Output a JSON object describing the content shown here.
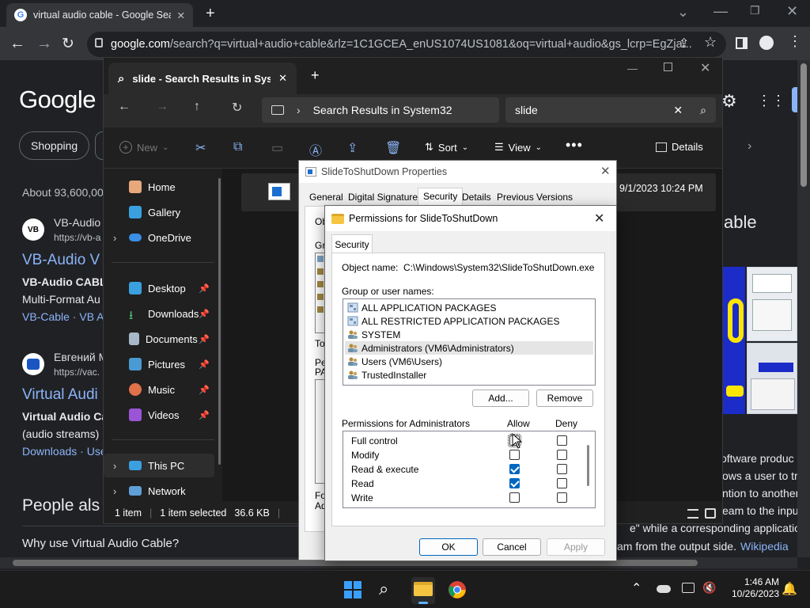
{
  "chrome": {
    "tab_title": "virtual audio cable - Google Sea",
    "url_host": "google.com",
    "url_rest": "/search?q=virtual+audio+cable&rlz=1C1GCEA_enUS1074US1081&oq=virtual+audio&gs_lcrp=EgZja..."
  },
  "google": {
    "logo": "Google",
    "chip_shopping": "Shopping",
    "about": "About 93,600,00",
    "result1": {
      "site": "VB-Audio",
      "url": "https://vb-a",
      "title": "VB-Audio V",
      "bold": "VB-Audio CABL",
      "desc": "Multi-Format Au",
      "links": "VB-Cable · VB Au"
    },
    "result2": {
      "site": "Евгений M",
      "url": "https://vac.",
      "title": "Virtual Audi",
      "bold": "Virtual Audio Ca",
      "desc": "(audio streams)",
      "links": "Downloads · Use"
    },
    "people": "People als",
    "why": "Why use Virtual Audio Cable?",
    "right_heading": "able",
    "right_text": [
      "oftware produc",
      "ows a user to tr",
      "ntion to another",
      "eam to the inpu",
      "e\" while a corresponding application",
      "am from the output side."
    ],
    "wikipedia": "Wikipedia"
  },
  "explorer": {
    "tab_title": "slide - Search Results in Syster",
    "address": "Search Results in System32",
    "search": "slide",
    "cmd": {
      "new": "New",
      "sort": "Sort",
      "view": "View",
      "details": "Details"
    },
    "nav": {
      "home": "Home",
      "gallery": "Gallery",
      "onedrive": "OneDrive",
      "desktop": "Desktop",
      "downloads": "Downloads",
      "documents": "Documents",
      "pictures": "Pictures",
      "music": "Music",
      "videos": "Videos",
      "thispc": "This PC",
      "network": "Network"
    },
    "file_date": "9/1/2023 10:24 PM",
    "status": {
      "count": "1 item",
      "selected": "1 item selected",
      "size": "36.6 KB"
    }
  },
  "properties": {
    "title": "SlideToShutDown Properties",
    "tabs": [
      "General",
      "Digital Signatures",
      "Security",
      "Details",
      "Previous Versions"
    ],
    "frag_ob": "Ob",
    "frag_gr": "Gro",
    "frag_to": "To",
    "frag_pe": "Pe",
    "frag_pa": "PA",
    "frag_fo": "For",
    "frag_ad": "Ad"
  },
  "permissions": {
    "title": "Permissions for SlideToShutDown",
    "tab": "Security",
    "object_label": "Object name:",
    "object_value": "C:\\Windows\\System32\\SlideToShutDown.exe",
    "group_label": "Group or user names:",
    "users": [
      "ALL APPLICATION PACKAGES",
      "ALL RESTRICTED APPLICATION PACKAGES",
      "SYSTEM",
      "Administrators (VM6\\Administrators)",
      "Users (VM6\\Users)",
      "TrustedInstaller"
    ],
    "add": "Add...",
    "remove": "Remove",
    "perm_label": "Permissions for Administrators",
    "allow": "Allow",
    "deny": "Deny",
    "rows": [
      {
        "name": "Full control",
        "allow": false,
        "deny": false
      },
      {
        "name": "Modify",
        "allow": false,
        "deny": false
      },
      {
        "name": "Read & execute",
        "allow": true,
        "deny": false
      },
      {
        "name": "Read",
        "allow": true,
        "deny": false
      },
      {
        "name": "Write",
        "allow": false,
        "deny": false
      }
    ],
    "ok": "OK",
    "cancel": "Cancel",
    "apply": "Apply"
  },
  "taskbar": {
    "time": "1:46 AM",
    "date": "10/26/2023"
  }
}
